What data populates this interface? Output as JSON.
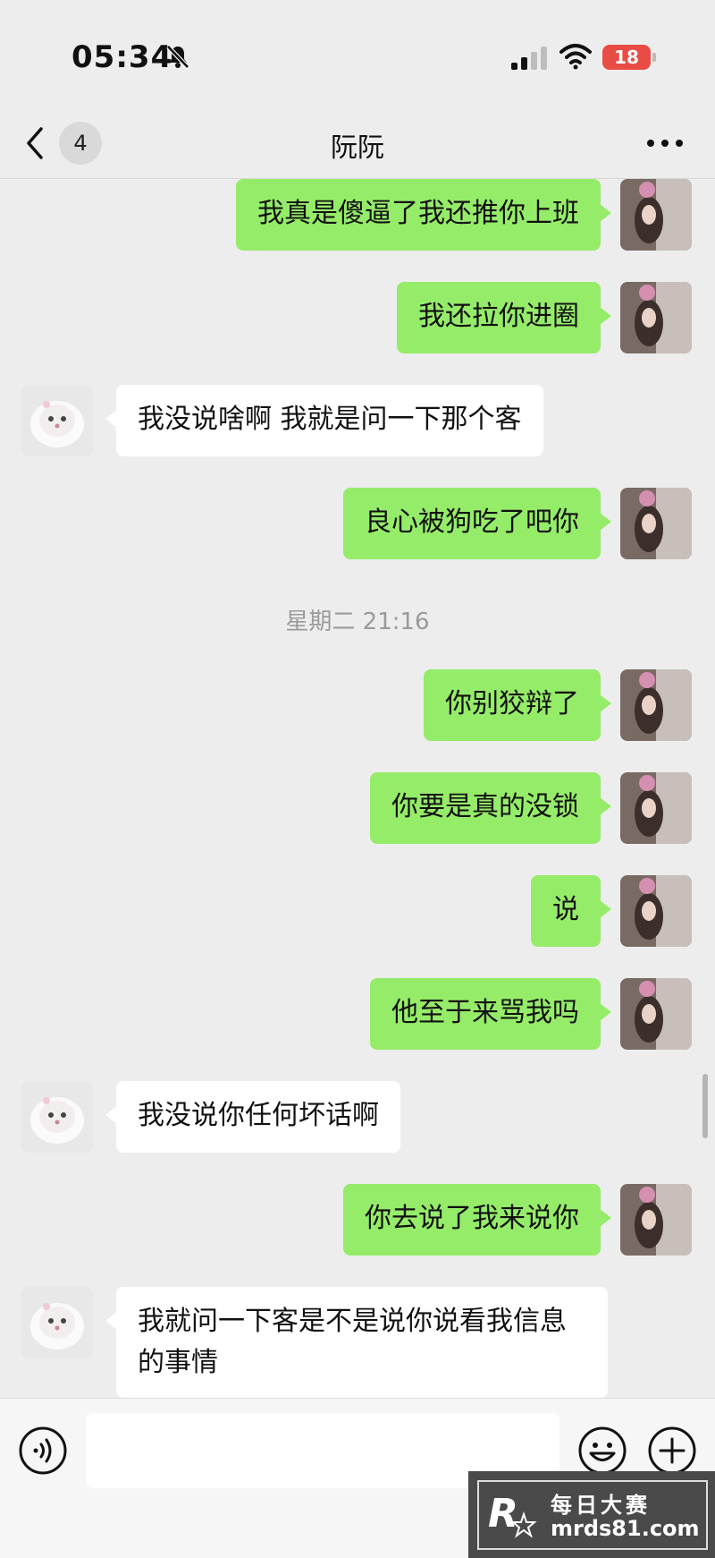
{
  "status_bar": {
    "time": "05:34",
    "battery": "18"
  },
  "header": {
    "unread_count": "4",
    "title": "阮阮"
  },
  "messages": [
    {
      "from": "me",
      "text": "我真是傻逼了我还推你上班"
    },
    {
      "from": "me",
      "text": "我还拉你进圈"
    },
    {
      "from": "peer",
      "text": "我没说啥啊 我就是问一下那个客"
    },
    {
      "from": "me",
      "text": "良心被狗吃了吧你"
    },
    {
      "timestamp": "星期二 21:16"
    },
    {
      "from": "me",
      "text": "你别狡辩了"
    },
    {
      "from": "me",
      "text": "你要是真的没锁"
    },
    {
      "from": "me",
      "text": "说"
    },
    {
      "from": "me",
      "text": "他至于来骂我吗"
    },
    {
      "from": "peer",
      "text": "我没说你任何坏话啊"
    },
    {
      "from": "me",
      "text": "你去说了我来说你"
    },
    {
      "from": "peer",
      "text": "我就问一下客是不是说你说看我信息的事情"
    }
  ],
  "input_bar": {
    "placeholder": ""
  },
  "watermark": {
    "title": "每日大赛",
    "url": "mrds81.com"
  },
  "colors": {
    "background": "#ededed",
    "my_bubble": "#95ec69",
    "peer_bubble": "#ffffff",
    "battery": "#e84c45"
  },
  "icons": {
    "mute": "bell-slash-icon",
    "signal": "signal-icon",
    "wifi": "wifi-icon",
    "back": "chevron-left-icon",
    "more": "more-dots-icon",
    "voice": "voice-icon",
    "emoji": "emoji-icon",
    "plus": "plus-icon"
  }
}
